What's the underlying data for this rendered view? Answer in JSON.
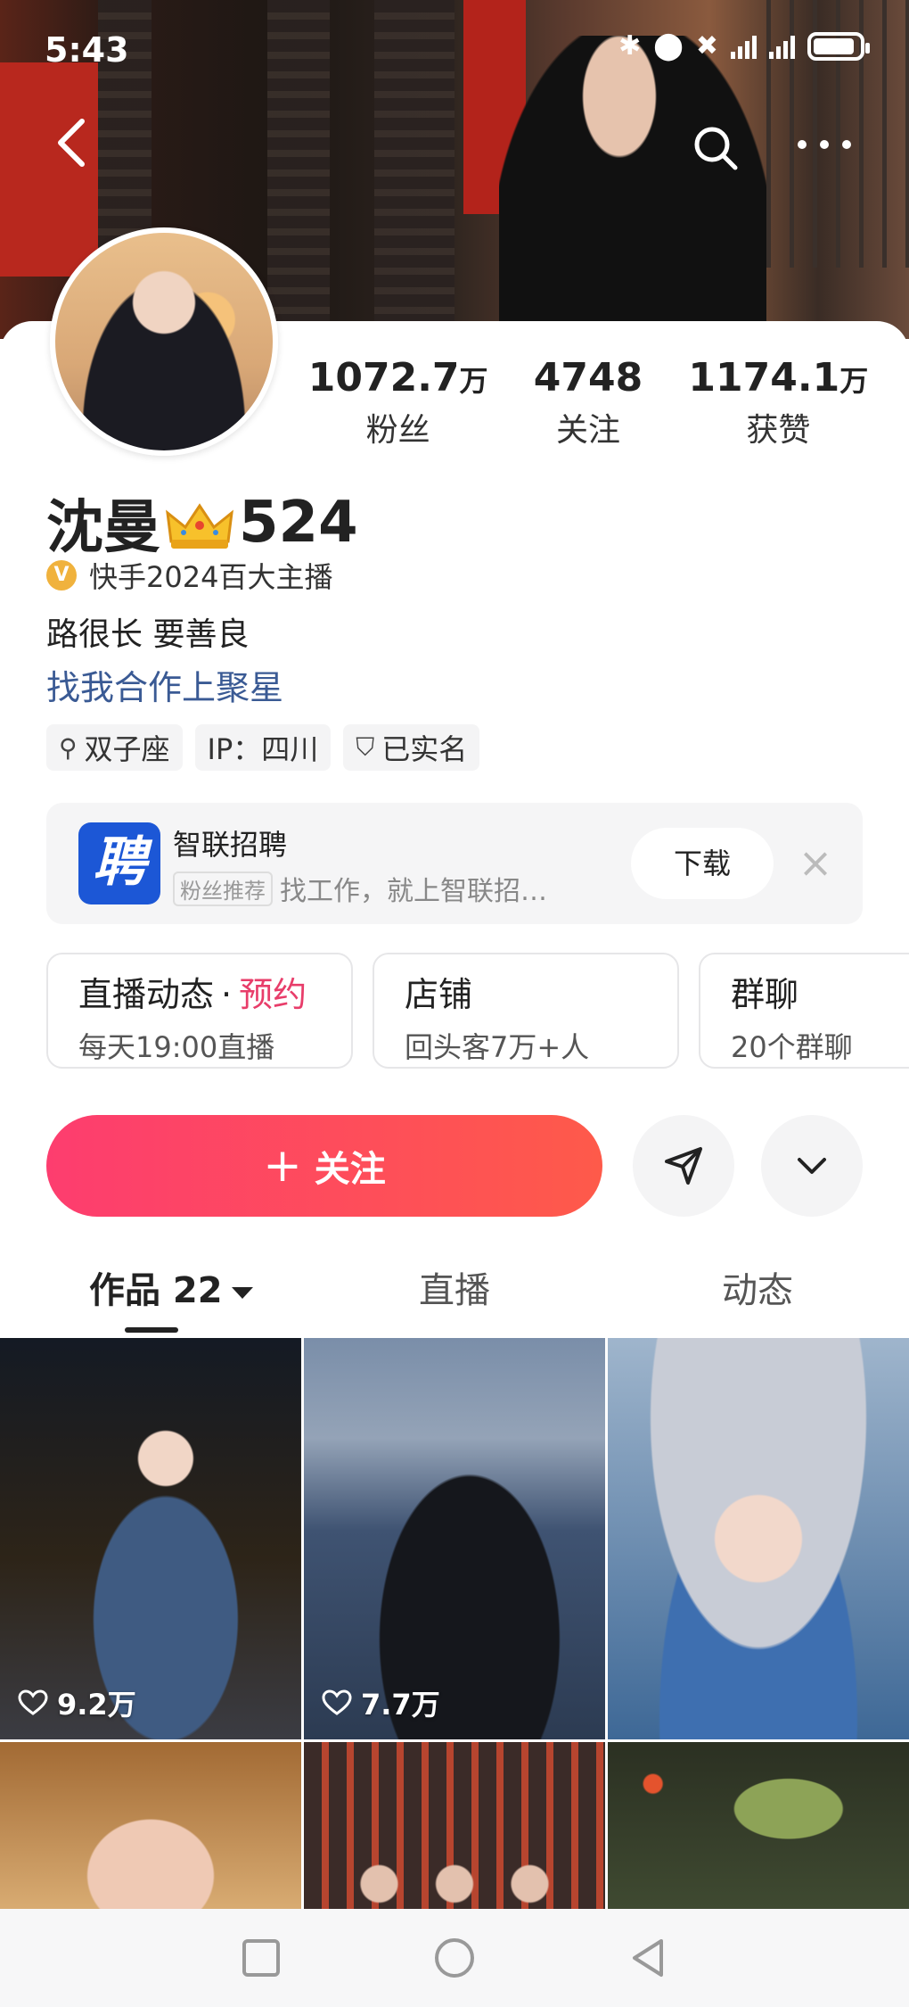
{
  "status_bar": {
    "time": "5:43",
    "battery_level": 0.9
  },
  "profile": {
    "name": "沈曼",
    "name_suffix": "524",
    "verified_label": "快手2024百大主播",
    "verified_badge": "V",
    "bio": "路很长 要善良",
    "link_text": "找我合作上聚星",
    "stats": [
      {
        "num": "1072.7",
        "unit": "万",
        "label": "粉丝"
      },
      {
        "num": "4748",
        "unit": "",
        "label": "关注"
      },
      {
        "num": "1174.1",
        "unit": "万",
        "label": "获赞"
      }
    ],
    "tags": [
      {
        "icon": "zodiac-icon",
        "glyph": "⚲",
        "text": "双子座"
      },
      {
        "icon": "",
        "glyph": "",
        "text": "IP：四川"
      },
      {
        "icon": "shield-check-icon",
        "glyph": "⛉",
        "text": "已实名"
      }
    ]
  },
  "ad": {
    "logo_text": "聘",
    "title": "智联招聘",
    "badge": "粉丝推荐",
    "subtitle": "找工作，就上智联招…",
    "download_label": "下载",
    "close_glyph": "×"
  },
  "quick_cards": [
    {
      "title": "直播动态",
      "dot": "·",
      "accent": "预约",
      "sub": "每天19:00直播"
    },
    {
      "title": "店铺",
      "dot": "",
      "accent": "",
      "sub": "回头客7万+人"
    },
    {
      "title": "群聊",
      "dot": "",
      "accent": "",
      "sub": "20个群聊"
    }
  ],
  "actions": {
    "follow_plus": "+",
    "follow_label": "关注"
  },
  "tabs": [
    {
      "label": "作品 22",
      "active": true
    },
    {
      "label": "直播",
      "active": false
    },
    {
      "label": "动态",
      "active": false
    }
  ],
  "videos": [
    {
      "likes": "9.2万"
    },
    {
      "likes": "7.7万"
    },
    {
      "likes": ""
    },
    {
      "likes": ""
    },
    {
      "likes": ""
    },
    {
      "likes": ""
    }
  ],
  "colors": {
    "accent": "#fd3d6f",
    "link": "#3a5a94",
    "pink_text": "#e83d6a",
    "verify": "#f0b23d"
  }
}
